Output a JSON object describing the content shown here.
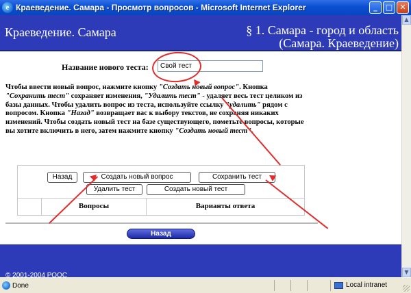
{
  "window": {
    "title": "Краеведение. Самара - Просмотр вопросов - Microsoft Internet Explorer"
  },
  "header": {
    "site_name": "Краеведение. Самара",
    "section_line1": "§ 1. Самара - город и область",
    "section_line2": "(Самара. Краеведение)"
  },
  "form": {
    "test_name_label": "Название нового теста:",
    "test_name_value": "Свой тест"
  },
  "instructions": [
    {
      "t": "Чтобы ввести новый вопрос, нажмите кнопку "
    },
    {
      "t": "\"Создать новый вопрос\"",
      "i": true
    },
    {
      "t": ". Кнопка "
    },
    {
      "t": "\"Сохранить тест\"",
      "i": true
    },
    {
      "t": " сохраняет изменения, "
    },
    {
      "t": "\"Удалить тест\"",
      "i": true
    },
    {
      "t": " - удаляет весь тест целиком из базы данных. Чтобы удалить вопрос из теста, используйте ссылку "
    },
    {
      "t": "\"удалить\"",
      "i": true
    },
    {
      "t": " рядом с вопросом. Кнопка "
    },
    {
      "t": "\"Назад\"",
      "i": true
    },
    {
      "t": " возвращает вас к выбору текстов, не сохраняя никаких изменений. Чтобы создать новый тест на базе существующего, пометьте вопросы, которые вы хотите включить в него, затем нажмите кнопку "
    },
    {
      "t": "\"Создать новый тест\"",
      "i": true
    },
    {
      "t": "."
    }
  ],
  "buttons": {
    "back": "Назад",
    "create_question": "Создать новый вопрос",
    "save_test": "Сохранить тест",
    "delete_test": "Удалить тест",
    "create_test": "Создать новый тест",
    "back_main": "Назад"
  },
  "table": {
    "col_questions": "Вопросы",
    "col_answers": "Варианты ответа"
  },
  "footer": {
    "copyright": "© 2001-2004 РООС"
  },
  "statusbar": {
    "status": "Done",
    "zone": "Local intranet"
  },
  "colors": {
    "header_bg": "#2e3bb8",
    "annotation": "#e12c2c"
  }
}
